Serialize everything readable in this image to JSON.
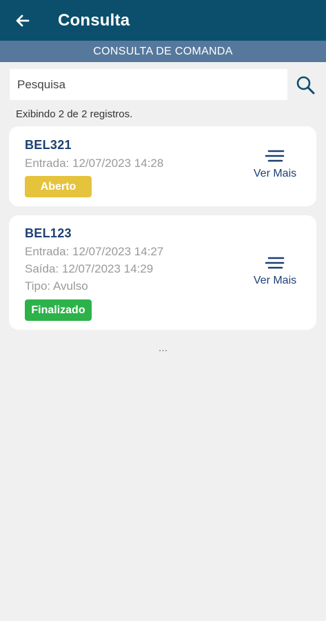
{
  "header": {
    "title": "Consulta"
  },
  "subheader": {
    "title": "CONSULTA DE COMANDA"
  },
  "search": {
    "placeholder": "Pesquisa"
  },
  "results": {
    "count_text": "Exibindo 2 de 2 registros."
  },
  "cards": [
    {
      "code": "BEL321",
      "entrada": "Entrada: 12/07/2023 14:28",
      "status": "Aberto",
      "more_label": "Ver Mais"
    },
    {
      "code": "BEL123",
      "entrada": "Entrada: 12/07/2023 14:27",
      "saida": "Saída: 12/07/2023 14:29",
      "tipo": "Tipo: Avulso",
      "status": "Finalizado",
      "more_label": "Ver Mais"
    }
  ],
  "footer": {
    "ellipsis": "..."
  },
  "colors": {
    "appbar": "#0b4f6c",
    "subheader": "#56789c",
    "accent_text": "#1b3f73",
    "status_open": "#e6c33d",
    "status_done": "#2db24a"
  },
  "icons": {
    "back": "arrow-left-icon",
    "search": "search-icon",
    "more": "lines-icon"
  }
}
